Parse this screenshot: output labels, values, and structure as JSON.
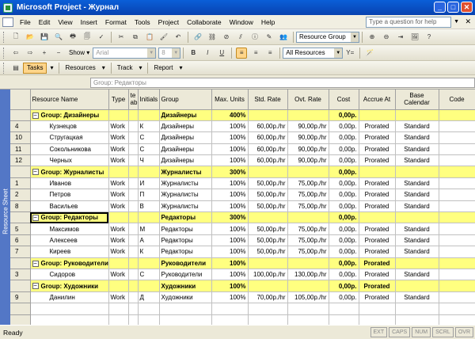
{
  "window": {
    "title": "Microsoft Project - Журнал"
  },
  "menu": {
    "items": [
      "File",
      "Edit",
      "View",
      "Insert",
      "Format",
      "Tools",
      "Project",
      "Collaborate",
      "Window",
      "Help"
    ],
    "ask_placeholder": "Type a question for help"
  },
  "toolbar_standard": {
    "group_combo": "Resource Group"
  },
  "toolbar_formatting": {
    "show_label": "Show",
    "font_combo": "Arial",
    "size_combo": "8",
    "filter_combo": "All Resources"
  },
  "toolbar_guide": {
    "tasks": "Tasks",
    "resources": "Resources",
    "track": "Track",
    "report": "Report"
  },
  "entry_bar": {
    "value": "Group: Редакторы"
  },
  "side_tab": "Resource Sheet",
  "columns": [
    "Resource Name",
    "Type",
    "te ab",
    "Initials",
    "Group",
    "Max. Units",
    "Std. Rate",
    "Ovt. Rate",
    "Cost",
    "Accrue At",
    "Base Calendar",
    "Code"
  ],
  "rows": [
    {
      "kind": "group",
      "name": "Group: Дизайнеры",
      "group": "Дизайнеры",
      "max": "400%",
      "cost": "0,00р."
    },
    {
      "kind": "res",
      "id": "4",
      "name": "Кузнецов",
      "type": "Work",
      "init": "К",
      "group": "Дизайнеры",
      "max": "100%",
      "std": "60,00р./hr",
      "ovt": "90,00р./hr",
      "cost": "0,00р.",
      "accrue": "Prorated",
      "cal": "Standard"
    },
    {
      "kind": "res",
      "id": "10",
      "name": "Стругацкая",
      "type": "Work",
      "init": "С",
      "group": "Дизайнеры",
      "max": "100%",
      "std": "60,00р./hr",
      "ovt": "90,00р./hr",
      "cost": "0,00р.",
      "accrue": "Prorated",
      "cal": "Standard"
    },
    {
      "kind": "res",
      "id": "11",
      "name": "Сокольникова",
      "type": "Work",
      "init": "С",
      "group": "Дизайнеры",
      "max": "100%",
      "std": "60,00р./hr",
      "ovt": "90,00р./hr",
      "cost": "0,00р.",
      "accrue": "Prorated",
      "cal": "Standard"
    },
    {
      "kind": "res",
      "id": "12",
      "name": "Черных",
      "type": "Work",
      "init": "Ч",
      "group": "Дизайнеры",
      "max": "100%",
      "std": "60,00р./hr",
      "ovt": "90,00р./hr",
      "cost": "0,00р.",
      "accrue": "Prorated",
      "cal": "Standard"
    },
    {
      "kind": "group",
      "name": "Group: Журналисты",
      "group": "Журналисты",
      "max": "300%",
      "cost": "0,00р."
    },
    {
      "kind": "res",
      "id": "1",
      "name": "Иванов",
      "type": "Work",
      "init": "И",
      "group": "Журналисты",
      "max": "100%",
      "std": "50,00р./hr",
      "ovt": "75,00р./hr",
      "cost": "0,00р.",
      "accrue": "Prorated",
      "cal": "Standard"
    },
    {
      "kind": "res",
      "id": "2",
      "name": "Петров",
      "type": "Work",
      "init": "П",
      "group": "Журналисты",
      "max": "100%",
      "std": "50,00р./hr",
      "ovt": "75,00р./hr",
      "cost": "0,00р.",
      "accrue": "Prorated",
      "cal": "Standard"
    },
    {
      "kind": "res",
      "id": "8",
      "name": "Васильев",
      "type": "Work",
      "init": "В",
      "group": "Журналисты",
      "max": "100%",
      "std": "50,00р./hr",
      "ovt": "75,00р./hr",
      "cost": "0,00р.",
      "accrue": "Prorated",
      "cal": "Standard"
    },
    {
      "kind": "group",
      "name": "Group: Редакторы",
      "group": "Редакторы",
      "max": "300%",
      "cost": "0,00р.",
      "selected": true
    },
    {
      "kind": "res",
      "id": "5",
      "name": "Максимов",
      "type": "Work",
      "init": "М",
      "group": "Редакторы",
      "max": "100%",
      "std": "50,00р./hr",
      "ovt": "75,00р./hr",
      "cost": "0,00р.",
      "accrue": "Prorated",
      "cal": "Standard"
    },
    {
      "kind": "res",
      "id": "6",
      "name": "Алексеев",
      "type": "Work",
      "init": "А",
      "group": "Редакторы",
      "max": "100%",
      "std": "50,00р./hr",
      "ovt": "75,00р./hr",
      "cost": "0,00р.",
      "accrue": "Prorated",
      "cal": "Standard"
    },
    {
      "kind": "res",
      "id": "7",
      "name": "Киреев",
      "type": "Work",
      "init": "К",
      "group": "Редакторы",
      "max": "100%",
      "std": "50,00р./hr",
      "ovt": "75,00р./hr",
      "cost": "0,00р.",
      "accrue": "Prorated",
      "cal": "Standard"
    },
    {
      "kind": "group",
      "name": "Group: Руководители",
      "group": "Руководители",
      "max": "100%",
      "cost": "0,00р.",
      "accrue": "Prorated"
    },
    {
      "kind": "res",
      "id": "3",
      "name": "Сидоров",
      "type": "Work",
      "init": "С",
      "group": "Руководители",
      "max": "100%",
      "std": "100,00р./hr",
      "ovt": "130,00р./hr",
      "cost": "0,00р.",
      "accrue": "Prorated",
      "cal": "Standard"
    },
    {
      "kind": "group",
      "name": "Group: Художники",
      "group": "Художники",
      "max": "100%",
      "cost": "0,00р.",
      "accrue": "Prorated"
    },
    {
      "kind": "res",
      "id": "9",
      "name": "Данилин",
      "type": "Work",
      "init": "Д",
      "group": "Художники",
      "max": "100%",
      "std": "70,00р./hr",
      "ovt": "105,00р./hr",
      "cost": "0,00р.",
      "accrue": "Prorated",
      "cal": "Standard"
    }
  ],
  "status": {
    "text": "Ready",
    "indicators": [
      "EXT",
      "CAPS",
      "NUM",
      "SCRL",
      "OVR"
    ]
  }
}
